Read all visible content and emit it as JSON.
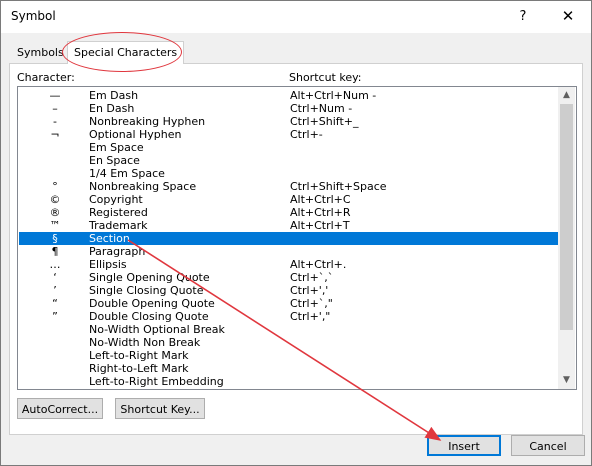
{
  "window": {
    "title": "Symbol",
    "help_label": "?",
    "close_label": "✕"
  },
  "tabs": [
    {
      "label": "Symbols",
      "active": false
    },
    {
      "label": "Special Characters",
      "active": true
    }
  ],
  "columns": {
    "character": "Character:",
    "shortcut": "Shortcut key:"
  },
  "rows": [
    {
      "glyph": "—",
      "name": "Em Dash",
      "key": "Alt+Ctrl+Num -"
    },
    {
      "glyph": "–",
      "name": "En Dash",
      "key": "Ctrl+Num -"
    },
    {
      "glyph": "-",
      "name": "Nonbreaking Hyphen",
      "key": "Ctrl+Shift+_"
    },
    {
      "glyph": "¬",
      "name": "Optional Hyphen",
      "key": "Ctrl+-"
    },
    {
      "glyph": "",
      "name": "Em Space",
      "key": ""
    },
    {
      "glyph": "",
      "name": "En Space",
      "key": ""
    },
    {
      "glyph": "",
      "name": "1/4 Em Space",
      "key": ""
    },
    {
      "glyph": "°",
      "name": "Nonbreaking Space",
      "key": "Ctrl+Shift+Space"
    },
    {
      "glyph": "©",
      "name": "Copyright",
      "key": "Alt+Ctrl+C"
    },
    {
      "glyph": "®",
      "name": "Registered",
      "key": "Alt+Ctrl+R"
    },
    {
      "glyph": "™",
      "name": "Trademark",
      "key": "Alt+Ctrl+T"
    },
    {
      "glyph": "§",
      "name": "Section",
      "key": "",
      "selected": true
    },
    {
      "glyph": "¶",
      "name": "Paragraph",
      "key": ""
    },
    {
      "glyph": "…",
      "name": "Ellipsis",
      "key": "Alt+Ctrl+."
    },
    {
      "glyph": "‘",
      "name": "Single Opening Quote",
      "key": "Ctrl+`,`"
    },
    {
      "glyph": "’",
      "name": "Single Closing Quote",
      "key": "Ctrl+','"
    },
    {
      "glyph": "“",
      "name": "Double Opening Quote",
      "key": "Ctrl+`,\""
    },
    {
      "glyph": "”",
      "name": "Double Closing Quote",
      "key": "Ctrl+',\""
    },
    {
      "glyph": "",
      "name": "No-Width Optional Break",
      "key": ""
    },
    {
      "glyph": "",
      "name": "No-Width Non Break",
      "key": ""
    },
    {
      "glyph": "",
      "name": "Left-to-Right Mark",
      "key": ""
    },
    {
      "glyph": "",
      "name": "Right-to-Left Mark",
      "key": ""
    },
    {
      "glyph": "",
      "name": "Left-to-Right Embedding",
      "key": ""
    }
  ],
  "buttons": {
    "autocorrect": "AutoCorrect...",
    "shortcut_key": "Shortcut Key...",
    "insert": "Insert",
    "cancel": "Cancel"
  },
  "colors": {
    "selection": "#0078d7",
    "annotation": "#e0373e"
  },
  "icons": {
    "scroll_up": "▲",
    "scroll_down": "▼"
  }
}
